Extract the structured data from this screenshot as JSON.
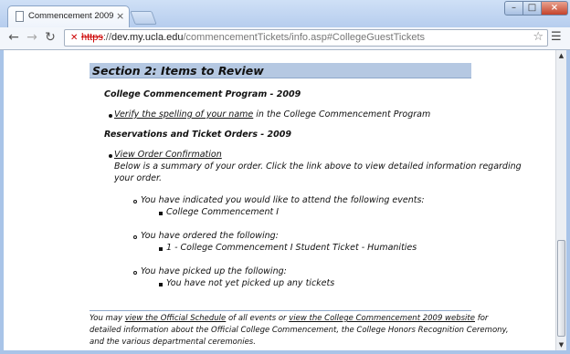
{
  "browser": {
    "tab_title": "Commencement 2009",
    "url_scheme": "https",
    "url_sep": "://",
    "url_host": "dev.my.ucla.edu",
    "url_path": "/commencementTickets/info.asp#CollegeGuestTickets"
  },
  "page": {
    "section_title": "Section 2: Items to Review",
    "program_heading": "College Commencement Program - 2009",
    "verify_link": "Verify the spelling of your name",
    "verify_rest": " in the College Commencement Program",
    "reservations_heading": "Reservations and Ticket Orders - 2009",
    "view_order_link": "View Order Confirmation",
    "summary_line1": "Below is a summary of your order. Click the link above to view detailed information regarding",
    "summary_line2": "your order.",
    "events_label": "You have indicated you would like to attend the following events:",
    "events_item": "College Commencement I",
    "ordered_label": "You have ordered the following:",
    "ordered_item": "1 - College Commencement I Student Ticket - Humanities",
    "picked_label": "You have picked up the following:",
    "picked_item": "You have not yet picked up any tickets",
    "footer_pre": "You may ",
    "footer_link1": "view the Official Schedule",
    "footer_mid": " of all events or ",
    "footer_link2": "view the College Commencement 2009 website",
    "footer_post": " for",
    "footer_line2": "detailed information about the Official College Commencement, the College Honors Recognition Ceremony,",
    "footer_line3": "and the various departmental ceremonies."
  }
}
